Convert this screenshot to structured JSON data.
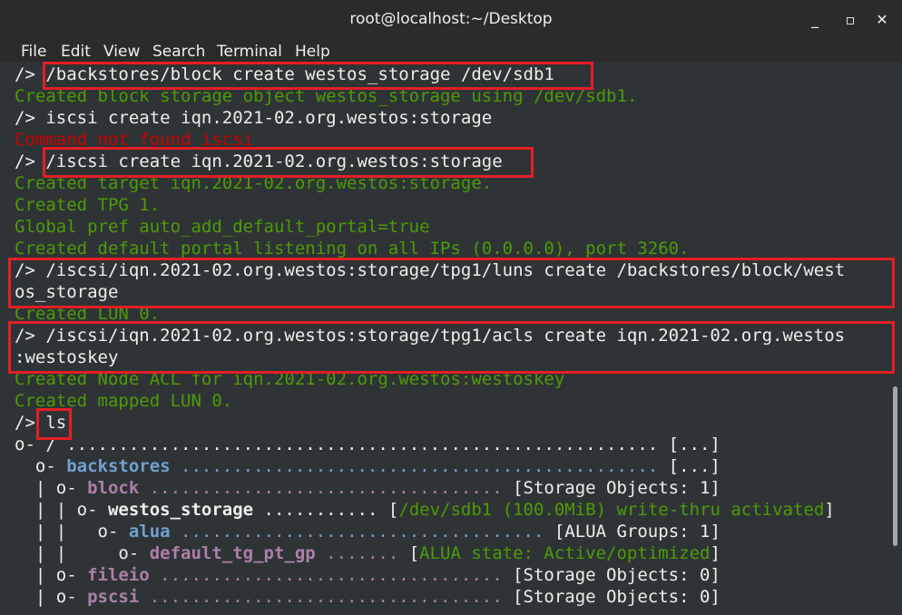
{
  "window": {
    "title": "root@localhost:~/Desktop",
    "minimize_glyph": "_",
    "maximize_glyph": "▫",
    "close_glyph": "✕"
  },
  "menu": {
    "file": "File",
    "edit": "Edit",
    "view": "View",
    "search": "Search",
    "terminal": "Terminal",
    "help": "Help"
  },
  "terminal": {
    "lines": [
      [
        {
          "t": "/> ",
          "c": "w"
        },
        {
          "t": "/backstores/block create westos_storage /dev/sdb1",
          "c": "w"
        }
      ],
      [
        {
          "t": "Created block storage object westos_storage using /dev/sdb1.",
          "c": "g"
        }
      ],
      [
        {
          "t": "/> iscsi create iqn.2021-02.org.westos:storage",
          "c": "w"
        }
      ],
      [
        {
          "t": "Command not found iscsi",
          "c": "r"
        }
      ],
      [
        {
          "t": "/> ",
          "c": "w"
        },
        {
          "t": "/iscsi create iqn.2021-02.org.westos:storage",
          "c": "w"
        }
      ],
      [
        {
          "t": "Created target iqn.2021-02.org.westos:storage.",
          "c": "g"
        }
      ],
      [
        {
          "t": "Created TPG 1.",
          "c": "g"
        }
      ],
      [
        {
          "t": "Global pref auto_add_default_portal=true",
          "c": "g"
        }
      ],
      [
        {
          "t": "Created default portal listening on all IPs (0.0.0.0), port 3260.",
          "c": "g"
        }
      ],
      [
        {
          "t": "/> /iscsi/iqn.2021-02.org.westos:storage/tpg1/luns create /backstores/block/west",
          "c": "w"
        }
      ],
      [
        {
          "t": "os_storage",
          "c": "w"
        }
      ],
      [
        {
          "t": "Created LUN 0.",
          "c": "g"
        }
      ],
      [
        {
          "t": "/> /iscsi/iqn.2021-02.org.westos:storage/tpg1/acls create iqn.2021-02.org.westos",
          "c": "w"
        }
      ],
      [
        {
          "t": ":westoskey",
          "c": "w"
        }
      ],
      [
        {
          "t": "Created Node ACL for iqn.2021-02.org.westos:westoskey",
          "c": "g"
        }
      ],
      [
        {
          "t": "Created mapped LUN 0.",
          "c": "g"
        }
      ],
      [
        {
          "t": "/> ",
          "c": "w"
        },
        {
          "t": "ls",
          "c": "w"
        }
      ],
      [
        {
          "t": "o- / ",
          "c": "w"
        },
        {
          "t": "......................................................... ",
          "c": "w"
        },
        {
          "t": "[...]",
          "c": "w"
        }
      ],
      [
        {
          "t": "  o- ",
          "c": "w"
        },
        {
          "t": "backstores",
          "c": "b",
          "bold": true
        },
        {
          "t": " .............................................. ",
          "c": "b"
        },
        {
          "t": "[...]",
          "c": "w"
        }
      ],
      [
        {
          "t": "  | o- ",
          "c": "w"
        },
        {
          "t": "block",
          "c": "p",
          "bold": true
        },
        {
          "t": " .................................. ",
          "c": "p"
        },
        {
          "t": "[Storage Objects: 1]",
          "c": "w"
        }
      ],
      [
        {
          "t": "  | | o- ",
          "c": "w"
        },
        {
          "t": "westos_storage",
          "c": "w",
          "bold": true
        },
        {
          "t": " ........... ",
          "c": "w"
        },
        {
          "t": "[",
          "c": "w"
        },
        {
          "t": "/dev/sdb1 (100.0MiB) write-thru activated",
          "c": "g"
        },
        {
          "t": "]",
          "c": "w"
        }
      ],
      [
        {
          "t": "  | |   o- ",
          "c": "w"
        },
        {
          "t": "alua",
          "c": "b",
          "bold": true
        },
        {
          "t": " ................................... ",
          "c": "b"
        },
        {
          "t": "[ALUA Groups: 1]",
          "c": "w"
        }
      ],
      [
        {
          "t": "  | |     o- ",
          "c": "w"
        },
        {
          "t": "default_tg_pt_gp",
          "c": "p",
          "bold": true
        },
        {
          "t": " ....... ",
          "c": "p"
        },
        {
          "t": "[",
          "c": "w"
        },
        {
          "t": "ALUA state: Active/optimized",
          "c": "g"
        },
        {
          "t": "]",
          "c": "w"
        }
      ],
      [
        {
          "t": "  | o- ",
          "c": "w"
        },
        {
          "t": "fileio",
          "c": "p",
          "bold": true
        },
        {
          "t": " ................................. ",
          "c": "p"
        },
        {
          "t": "[Storage Objects: 0]",
          "c": "w"
        }
      ],
      [
        {
          "t": "  | o- ",
          "c": "w"
        },
        {
          "t": "pscsi",
          "c": "p",
          "bold": true
        },
        {
          "t": " .................................. ",
          "c": "p"
        },
        {
          "t": "[Storage Objects: 0]",
          "c": "w"
        }
      ]
    ]
  },
  "colors": {
    "background": "#2e3436",
    "green": "#4e9a06",
    "red": "#cc0000",
    "blue": "#729fcf",
    "purple": "#ad7fa8",
    "highlight": "#e41e26"
  }
}
